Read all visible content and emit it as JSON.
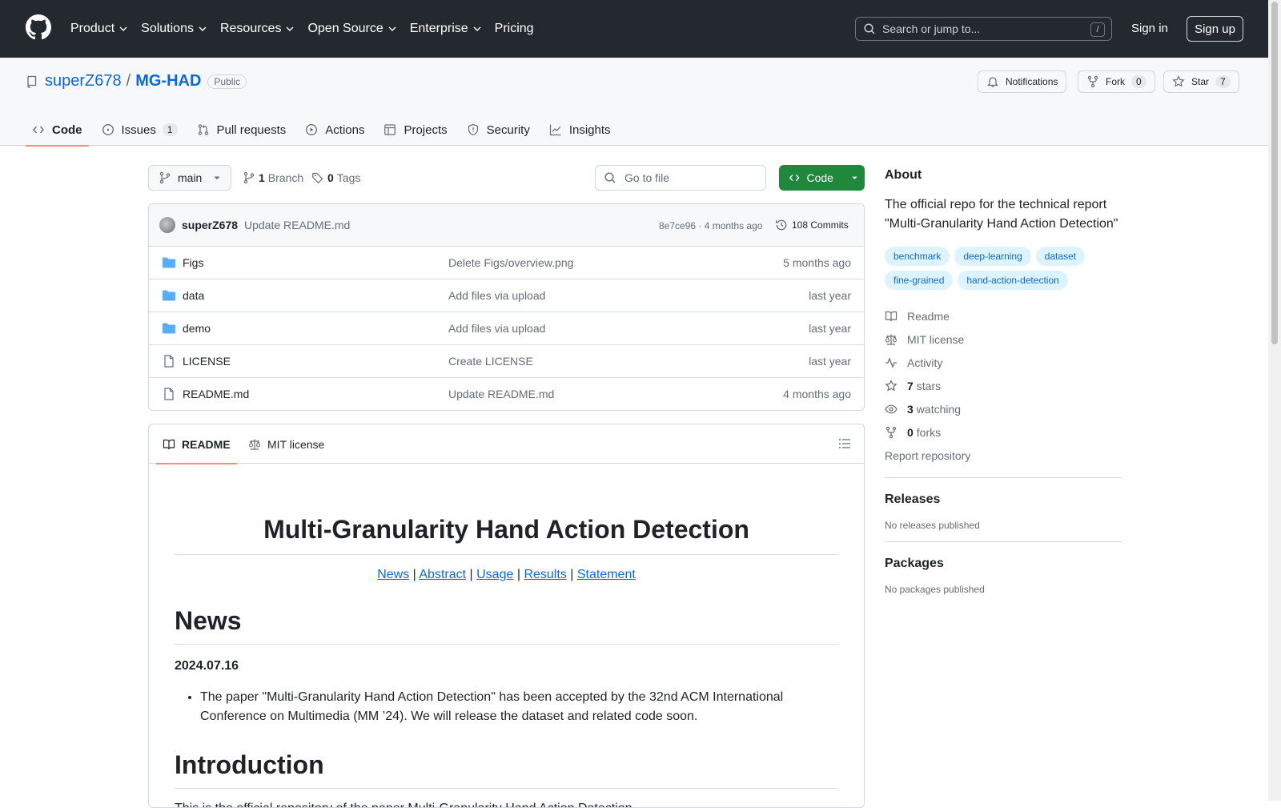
{
  "header": {
    "nav": [
      "Product",
      "Solutions",
      "Resources",
      "Open Source",
      "Enterprise",
      "Pricing"
    ],
    "search_placeholder": "Search or jump to...",
    "search_shortcut": "/",
    "signin": "Sign in",
    "signup": "Sign up"
  },
  "repo": {
    "owner": "superZ678",
    "separator": "/",
    "name": "MG-HAD",
    "visibility": "Public",
    "notifications_label": "Notifications",
    "fork_label": "Fork",
    "fork_count": "0",
    "star_label": "Star",
    "star_count": "7"
  },
  "tabs": [
    {
      "label": "Code",
      "count": ""
    },
    {
      "label": "Issues",
      "count": "1"
    },
    {
      "label": "Pull requests",
      "count": ""
    },
    {
      "label": "Actions",
      "count": ""
    },
    {
      "label": "Projects",
      "count": ""
    },
    {
      "label": "Security",
      "count": ""
    },
    {
      "label": "Insights",
      "count": ""
    }
  ],
  "toolbar": {
    "branch": "main",
    "branch_count": "1",
    "branch_label": "Branch",
    "tag_count": "0",
    "tag_label": "Tags",
    "goto_file": "Go to file",
    "code_button": "Code"
  },
  "commit": {
    "author": "superZ678",
    "message": "Update README.md",
    "hash_time": "8e7ce96 · 4 months ago",
    "commits": "108 Commits"
  },
  "files": [
    {
      "name": "Figs",
      "type": "folder",
      "message": "Delete Figs/overview.png",
      "time": "5 months ago"
    },
    {
      "name": "data",
      "type": "folder",
      "message": "Add files via upload",
      "time": "last year"
    },
    {
      "name": "demo",
      "type": "folder",
      "message": "Add files via upload",
      "time": "last year"
    },
    {
      "name": "LICENSE",
      "type": "file",
      "message": "Create LICENSE",
      "time": "last year"
    },
    {
      "name": "README.md",
      "type": "file",
      "message": "Update README.md",
      "time": "4 months ago"
    }
  ],
  "readme": {
    "tab_readme": "README",
    "tab_license": "MIT license",
    "title": "Multi-Granularity Hand Action Detection",
    "links": [
      "News",
      "Abstract",
      "Usage",
      "Results",
      "Statement"
    ],
    "link_sep": "|",
    "news_heading": "News",
    "news_date": "2024.07.16",
    "news_item": "The paper \"Multi-Granularity Hand Action Detection\" has been accepted by the 32nd ACM International Conference on Multimedia (MM ’24). We will release the dataset and related code soon.",
    "intro_heading": "Introduction",
    "intro_text": "This is the official repository of the paper Multi-Granularity Hand Action Detection."
  },
  "about": {
    "heading": "About",
    "description": "The official repo for the technical report \"Multi-Granularity Hand Action Detection\"",
    "topics": [
      "benchmark",
      "deep-learning",
      "dataset",
      "fine-grained",
      "hand-action-detection"
    ],
    "readme": "Readme",
    "license": "MIT license",
    "activity": "Activity",
    "stars_count": "7",
    "stars_label": "stars",
    "watching_count": "3",
    "watching_label": "watching",
    "forks_count": "0",
    "forks_label": "forks",
    "report": "Report repository"
  },
  "releases": {
    "heading": "Releases",
    "text": "No releases published"
  },
  "packages": {
    "heading": "Packages",
    "text": "No packages published"
  },
  "colors": {
    "header_bg": "#24292f",
    "accent": "#0969da",
    "code_button": "#1f883d",
    "tab_underline": "#fd8c73"
  }
}
